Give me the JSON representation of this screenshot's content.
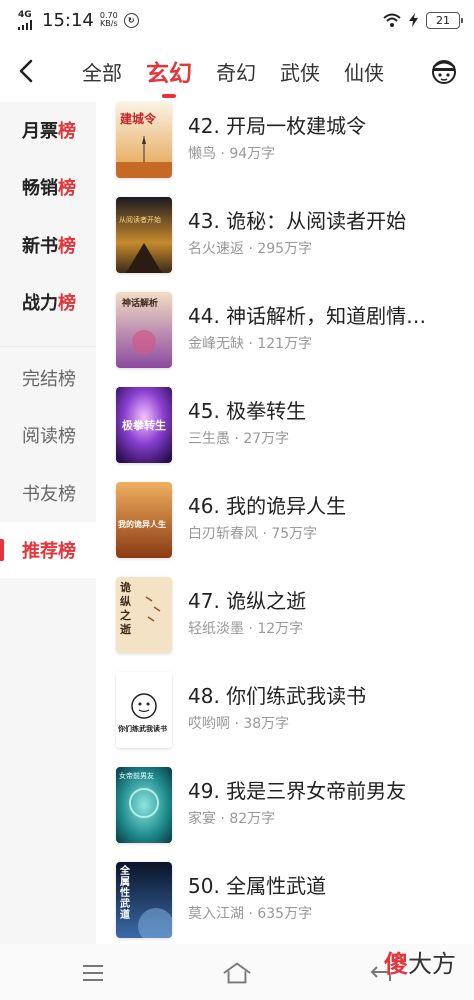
{
  "status_bar": {
    "signal": "4G",
    "network_type": "HD",
    "time": "15:14",
    "speed_value": "0.70",
    "speed_unit": "KB/s",
    "sync_icon": "sync-circle-icon",
    "battery": "21"
  },
  "top_tabs": {
    "back_icon": "chevron-left-icon",
    "items": [
      {
        "label": "全部",
        "active": false
      },
      {
        "label": "玄幻",
        "active": true
      },
      {
        "label": "奇幻",
        "active": false
      },
      {
        "label": "武侠",
        "active": false
      },
      {
        "label": "仙侠",
        "active": false
      }
    ],
    "avatar_icon": "avatar-face-icon",
    "accent_color": "#e5343a"
  },
  "sidebar": {
    "items": [
      {
        "label_main": "月票",
        "label_accent": "榜",
        "type": "hot"
      },
      {
        "label_main": "畅销",
        "label_accent": "榜",
        "type": "hot"
      },
      {
        "label_main": "新书",
        "label_accent": "榜",
        "type": "hot"
      },
      {
        "label_main": "战力",
        "label_accent": "榜",
        "type": "hot"
      },
      {
        "label": "完结榜",
        "type": "normal"
      },
      {
        "label": "阅读榜",
        "type": "normal"
      },
      {
        "label": "书友榜",
        "type": "normal"
      },
      {
        "label": "推荐榜",
        "type": "active"
      }
    ]
  },
  "books": [
    {
      "title": "42. 开局一枚建城令",
      "author": "懒鸟",
      "words": "94万字",
      "cover_text": "建城令"
    },
    {
      "title": "43. 诡秘：从阅读者开始",
      "author": "名火速返",
      "words": "295万字",
      "cover_text": "从阅读者开始"
    },
    {
      "title": "44. 神话解析，知道剧情…",
      "author": "金峰无缺",
      "words": "121万字",
      "cover_text": "神话解析"
    },
    {
      "title": "45. 极拳转生",
      "author": "三生愚",
      "words": "27万字",
      "cover_text": "极拳转生"
    },
    {
      "title": "46. 我的诡异人生",
      "author": "白刃斩春风",
      "words": "75万字",
      "cover_text": "我的诡异人生"
    },
    {
      "title": "47. 诡纵之逝",
      "author": "轻纸淡墨",
      "words": "12万字",
      "cover_text": "诡纵之逝"
    },
    {
      "title": "48. 你们练武我读书",
      "author": "哎哟啊",
      "words": "38万字",
      "cover_text": "你们练武我读书"
    },
    {
      "title": "49. 我是三界女帝前男友",
      "author": "家宴",
      "words": "82万字",
      "cover_text": "女帝前男友"
    },
    {
      "title": "50. 全属性武道",
      "author": "莫入江湖",
      "words": "635万字",
      "cover_text": "全属性武道"
    }
  ],
  "bottom_nav": {
    "menu_icon": "menu-lines-icon",
    "home_icon": "home-icon",
    "back_icon": "back-arrow-icon"
  },
  "watermark": {
    "char_red": "傻",
    "rest": "大方"
  }
}
